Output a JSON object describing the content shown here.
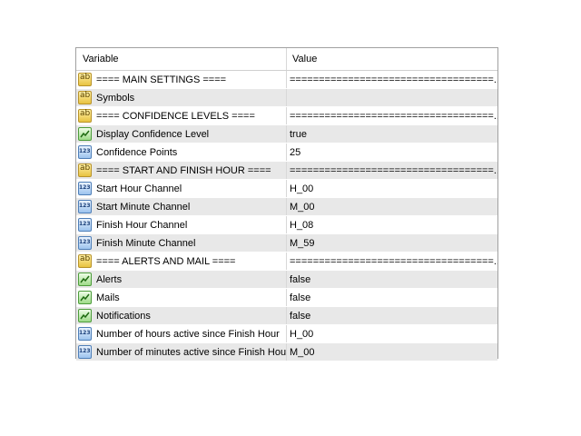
{
  "columns": {
    "variable": "Variable",
    "value": "Value"
  },
  "rows": [
    {
      "icon": "string-icon",
      "type": "ab",
      "name": "==== MAIN SETTINGS ====",
      "value": "===================================..."
    },
    {
      "icon": "string-icon",
      "type": "ab",
      "name": "Symbols",
      "value": ""
    },
    {
      "icon": "string-icon",
      "type": "ab",
      "name": "==== CONFIDENCE LEVELS ====",
      "value": "===================================..."
    },
    {
      "icon": "bool-icon",
      "type": "bool",
      "name": "Display Confidence Level",
      "value": "true"
    },
    {
      "icon": "number-icon",
      "type": "num",
      "name": "Confidence Points",
      "value": "25"
    },
    {
      "icon": "string-icon",
      "type": "ab",
      "name": "==== START AND FINISH HOUR ====",
      "value": "===================================..."
    },
    {
      "icon": "number-icon",
      "type": "num",
      "name": "Start Hour Channel",
      "value": "H_00"
    },
    {
      "icon": "number-icon",
      "type": "num",
      "name": "Start Minute Channel",
      "value": "M_00"
    },
    {
      "icon": "number-icon",
      "type": "num",
      "name": "Finish Hour Channel",
      "value": "H_08"
    },
    {
      "icon": "number-icon",
      "type": "num",
      "name": "Finish Minute Channel",
      "value": "M_59"
    },
    {
      "icon": "string-icon",
      "type": "ab",
      "name": "==== ALERTS AND MAIL ====",
      "value": "===================================..."
    },
    {
      "icon": "bool-icon",
      "type": "bool",
      "name": "Alerts",
      "value": "false"
    },
    {
      "icon": "bool-icon",
      "type": "bool",
      "name": "Mails",
      "value": "false"
    },
    {
      "icon": "bool-icon",
      "type": "bool",
      "name": "Notifications",
      "value": "false"
    },
    {
      "icon": "number-icon",
      "type": "num",
      "name": "Number of hours active since Finish Hour",
      "value": "H_00"
    },
    {
      "icon": "number-icon",
      "type": "num",
      "name": "Number of minutes active since Finish Hour",
      "value": "M_00"
    }
  ]
}
